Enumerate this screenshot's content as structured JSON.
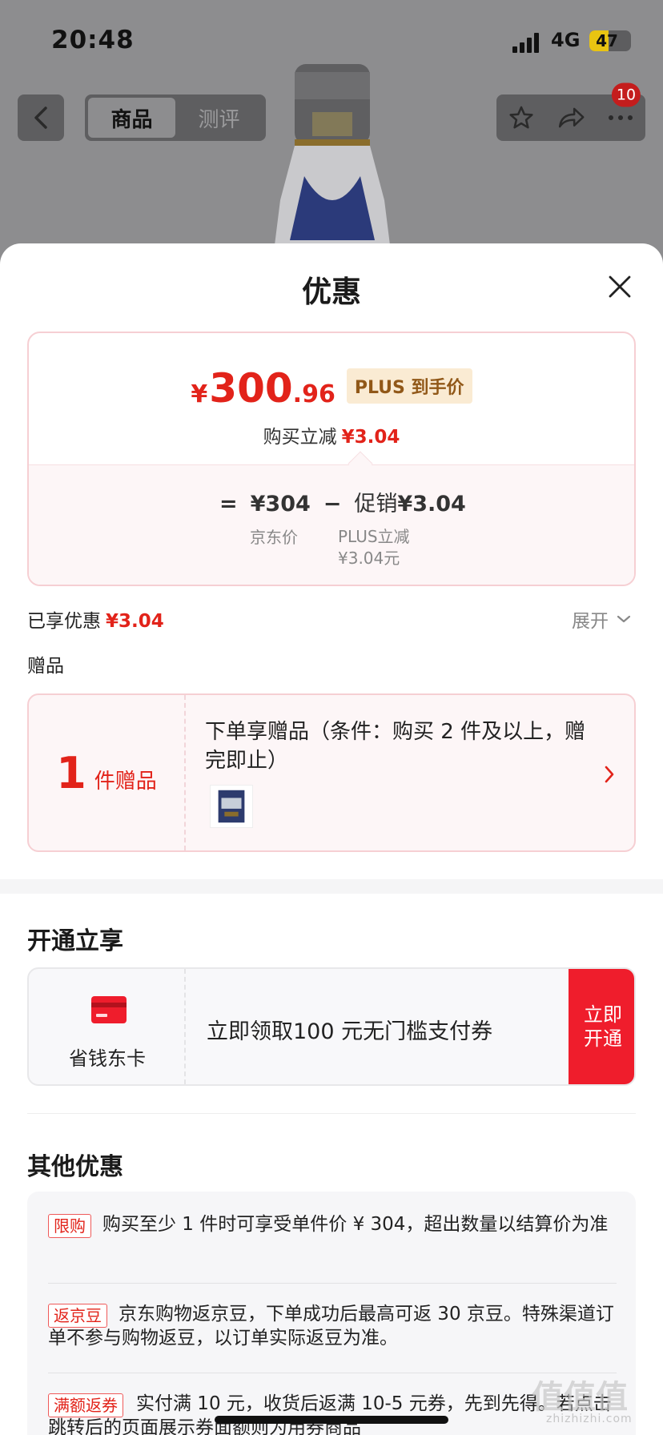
{
  "status_bar": {
    "time": "20:48",
    "network": "4G",
    "battery": "47",
    "battery_level": 0.47
  },
  "nav": {
    "tabs": [
      {
        "label": "商品"
      },
      {
        "label": "测评"
      }
    ],
    "badge": "10"
  },
  "sheet": {
    "title": "优惠",
    "price": {
      "yen": "¥",
      "integer": "300",
      "decimal": ".96",
      "plus_tag": "PLUS 到手价",
      "reduce_label": "购买立减",
      "reduce_value": "¥3.04",
      "equals": "=",
      "jd_price": "¥304",
      "minus": "−",
      "promo_label": "促销",
      "promo_value": "¥3.04",
      "jd_price_label": "京东价",
      "plus_reduce_label": "PLUS立减",
      "plus_reduce_value": "¥3.04元"
    },
    "enjoyed_label": "已享优惠",
    "enjoyed_value": "¥3.04",
    "expand_label": "展开",
    "gifts_label": "赠品",
    "gift": {
      "count": "1",
      "unit": "件赠品",
      "text": "下单享赠品（条件：购买 2 件及以上，赠完即止）"
    },
    "plus_section_title": "开通立享",
    "plus_card": {
      "name": "省钱东卡",
      "text": "立即领取100 元无门槛支付券",
      "button": "立即开通"
    },
    "other_title": "其他优惠",
    "promos": [
      {
        "tag": "限购",
        "text": "购买至少 1 件时可享受单件价 ¥ 304，超出数量以结算价为准"
      },
      {
        "tag": "返京豆",
        "text": "京东购物返京豆，下单成功后最高可返 30 京豆。特殊渠道订单不参与购物返豆，以订单实际返豆为准。"
      },
      {
        "tag": "满额返券",
        "text": "实付满 10 元，收货后返满 10-5 元券，先到先得。若点击跳转后的页面展示券面额则为用券商品"
      }
    ]
  },
  "watermark": {
    "text": "值值值",
    "sub": "zhizhizhi.com"
  },
  "colors": {
    "accent": "#e2231a",
    "gold_bg": "#faebd3",
    "gold_text": "#915818",
    "button": "#ef1d2c"
  }
}
